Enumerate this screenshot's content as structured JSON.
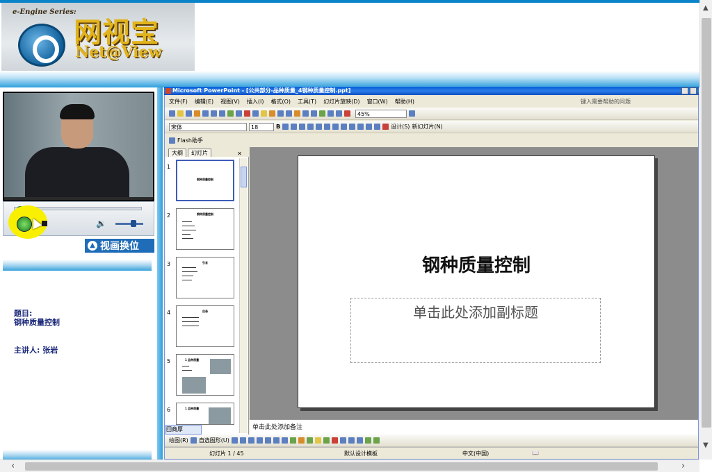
{
  "logo": {
    "series": "e-Engine Series:",
    "cn": "网视宝",
    "en": "Net@View"
  },
  "left": {
    "swap_label": "视画换位",
    "topic_label": "题目:",
    "topic_value": "钢种质量控制",
    "presenter": "主讲人:  张岩"
  },
  "player": {
    "progress": 0.03
  },
  "ppt": {
    "title": "Microsoft PowerPoint - [公共部分-品种质量_4钢种质量控制.ppt]",
    "menu": [
      "文件(F)",
      "编辑(E)",
      "视图(V)",
      "插入(I)",
      "格式(O)",
      "工具(T)",
      "幻灯片放映(D)",
      "窗口(W)",
      "帮助(H)"
    ],
    "help_placeholder": "键入需要帮助的问题",
    "zoom": "45%",
    "font": "宋体",
    "font_size": "18",
    "design_label": "设计(S)",
    "new_slide_label": "新幻灯片(N)",
    "flash_label": "Flash助手",
    "tabs": [
      "大纲",
      "幻灯片"
    ],
    "thumbnails": [
      {
        "num": "1",
        "title": "钢种质量控制"
      },
      {
        "num": "2",
        "title": "钢种质量控制"
      },
      {
        "num": "3",
        "title": "引言"
      },
      {
        "num": "4",
        "title": "目录"
      },
      {
        "num": "5",
        "title": "1  品种质量"
      },
      {
        "num": "6",
        "title": "1  品种质量"
      }
    ],
    "slide_title": "钢种质量控制",
    "slide_subtitle": "单击此处添加副标题",
    "notes": "单击此处添加备注",
    "view_label": "回商厚",
    "draw_label": "绘图(R)",
    "autoshape_label": "自选图形(U)",
    "status": {
      "slide": "幻灯片 1 / 45",
      "template": "默认设计模板",
      "language": "中文(中国)"
    }
  }
}
